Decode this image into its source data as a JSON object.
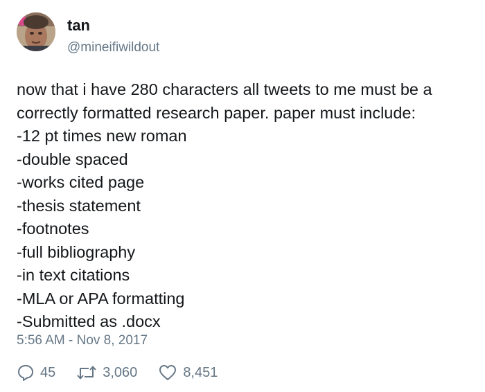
{
  "author": {
    "display_name": "tan",
    "handle": "@mineifiwildout",
    "avatar_icon": "profile-photo"
  },
  "tweet": {
    "lines": [
      "now that i have 280 characters all tweets to me must be a",
      "correctly formatted research paper. paper must include:",
      "-12 pt times new roman",
      "-double spaced",
      "-works cited page",
      "-thesis statement",
      "-footnotes",
      "-full bibliography",
      "-in text citations",
      "-MLA or APA formatting",
      "-Submitted as .docx"
    ],
    "timestamp": "5:56 AM - Nov 8, 2017"
  },
  "actions": {
    "reply": {
      "icon": "reply-icon",
      "count": "45"
    },
    "retweet": {
      "icon": "retweet-icon",
      "count": "3,060"
    },
    "like": {
      "icon": "heart-icon",
      "count": "8,451"
    }
  },
  "colors": {
    "text": "#14171a",
    "secondary": "#657786"
  }
}
